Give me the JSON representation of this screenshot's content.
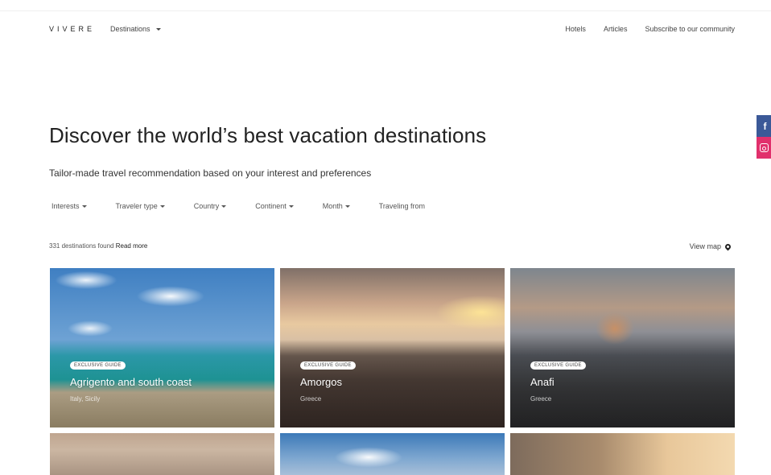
{
  "header": {
    "logo": "VIVERE",
    "destinations_label": "Destinations",
    "nav": [
      "Hotels",
      "Articles",
      "Subscribe to our community"
    ]
  },
  "social": {
    "facebook_glyph": "f",
    "icons": [
      "facebook-icon",
      "instagram-icon"
    ]
  },
  "hero": {
    "title": "Discover the world’s best vacation destinations",
    "subtitle": "Tailor-made travel recommendation based on your interest and preferences"
  },
  "filters": [
    {
      "label": "Interests",
      "has_dropdown": true
    },
    {
      "label": "Traveler type",
      "has_dropdown": true
    },
    {
      "label": "Country",
      "has_dropdown": true
    },
    {
      "label": "Continent",
      "has_dropdown": true
    },
    {
      "label": "Month",
      "has_dropdown": true
    },
    {
      "label": "Traveling from",
      "has_dropdown": false
    }
  ],
  "results": {
    "count_text": "331 destinations found",
    "read_more": "Read more",
    "view_map": "View map"
  },
  "cards": [
    {
      "badge": "EXCLUSIVE GUIDE",
      "name": "Agrigento and south coast",
      "country": "Italy, Sicily"
    },
    {
      "badge": "EXCLUSIVE GUIDE",
      "name": "Amorgos",
      "country": "Greece"
    },
    {
      "badge": "EXCLUSIVE GUIDE",
      "name": "Anafi",
      "country": "Greece"
    }
  ],
  "colors": {
    "facebook": "#3b5998",
    "instagram": "#e1306c",
    "text": "#222222"
  }
}
